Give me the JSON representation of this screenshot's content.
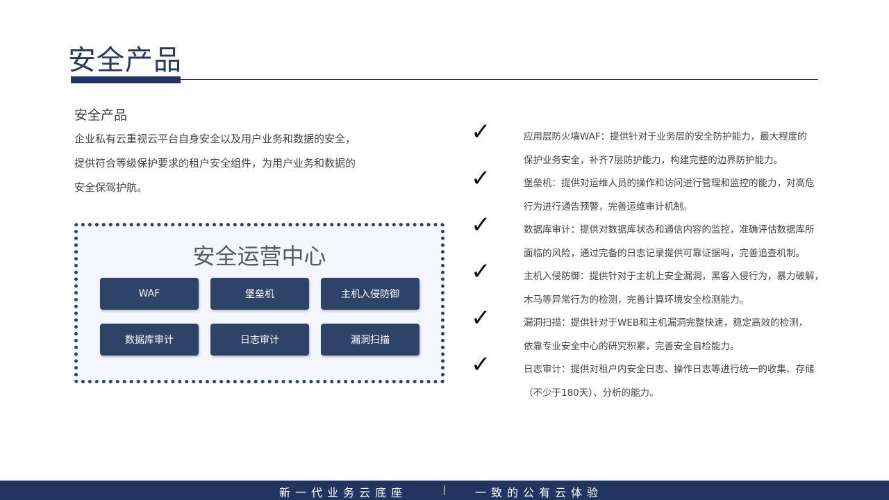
{
  "header": {
    "title": "安全产品"
  },
  "intro": {
    "heading": "安全产品",
    "lines": [
      "企业私有云重视云平台自身安全以及用户业务和数据的安全，",
      "提供符合等级保护要求的租户安全组件，为用户业务和数据的",
      "安全保驾护航。"
    ]
  },
  "ops_center": {
    "title": "安全运营中心",
    "buttons": [
      "WAF",
      "堡垒机",
      "主机入侵防御",
      "数据库审计",
      "日志审计",
      "漏洞扫描"
    ]
  },
  "features": [
    {
      "check": "✓",
      "lines": [
        "应用层防火墙WAF：提供针对于业务层的安全防护能力，最大程度的",
        "保护业务安全，补齐7层防护能力，构建完整的边界防护能力。"
      ]
    },
    {
      "check": "✓",
      "lines": [
        "堡垒机：提供对运维人员的操作和访问进行管理和监控的能力，对高危",
        "行为进行通告预警，完善运维审计机制。"
      ]
    },
    {
      "check": "✓",
      "lines": [
        "数据库审计：提供对数据库状态和通信内容的监控，准确评估数据库所",
        "面临的风险，通过完备的日志记录提供可靠证据吗，完善追查机制。"
      ]
    },
    {
      "check": "✓",
      "lines": [
        "主机入侵防御：提供针对于主机上安全漏洞，黑客入侵行为，暴力破解，",
        "木马等异常行为的检测，完善计算环境安全检测能力。"
      ]
    },
    {
      "check": "✓",
      "lines": [
        "漏洞扫描：提供针对于WEB和主机漏洞完整快速，稳定高效的检测，",
        "依靠专业安全中心的研究积累，完善安全自检能力。"
      ]
    },
    {
      "check": "✓",
      "lines": [
        "日志审计：提供对租户内安全日志、操作日志等进行统一的收集、存储",
        "（不少于180天）、分析的能力。"
      ]
    }
  ],
  "footer": {
    "left": "新一代业务云底座",
    "right": "一致的公有云体验"
  }
}
